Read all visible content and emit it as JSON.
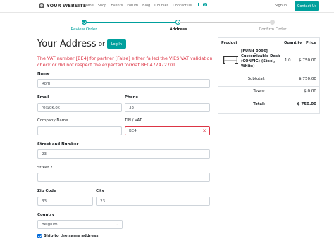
{
  "navbar": {
    "brand": "YOUR WEBSITE",
    "links": [
      "Home",
      "Shop",
      "Events",
      "Forum",
      "Blog",
      "Courses",
      "Contact us..."
    ],
    "cart_count": "0",
    "signin": "Sign in",
    "contact_button": "Contact Us"
  },
  "wizard": {
    "steps": [
      {
        "label": "Review Order",
        "state": "done"
      },
      {
        "label": "Address",
        "state": "current"
      },
      {
        "label": "Confirm Order",
        "state": "todo"
      }
    ]
  },
  "page": {
    "title": "Your Address",
    "or": "or",
    "login_button": "Log In",
    "alert": "The VAT number [BE4] for partner [False] either failed the VIES VAT validation check or did not respect the expected format BE0477472701."
  },
  "form": {
    "name_label": "Name",
    "name_value": "Rom",
    "email_label": "Email",
    "email_value": "re@ok.ok",
    "phone_label": "Phone",
    "phone_value": "33",
    "company_label": "Company Name",
    "company_value": "",
    "vat_label": "TIN / VAT",
    "vat_value": "BE4",
    "street_label": "Street and Number",
    "street_value": "23",
    "street2_label": "Street 2",
    "street2_value": "",
    "zip_label": "Zip Code",
    "zip_value": "33",
    "city_label": "City",
    "city_value": "23",
    "country_label": "Country",
    "country_value": "Belgium",
    "ship_same_label": "Ship to the same address",
    "ship_same_checked": true
  },
  "summary": {
    "headers": {
      "product": "Product",
      "quantity": "Quantity",
      "price": "Price"
    },
    "item": {
      "name": "[FURN_0096] Customizable Desk (CONFIG) (Steel, White)",
      "quantity": "1.0",
      "price": "$ 750.00"
    },
    "subtotal_label": "Subtotal:",
    "subtotal_value": "$ 750.00",
    "taxes_label": "Taxes:",
    "taxes_value": "$ 0.00",
    "total_label": "Total:",
    "total_value": "$ 750.00"
  },
  "colors": {
    "accent": "#00a09d",
    "error": "#dc3545",
    "checkbox": "#0069d9"
  }
}
